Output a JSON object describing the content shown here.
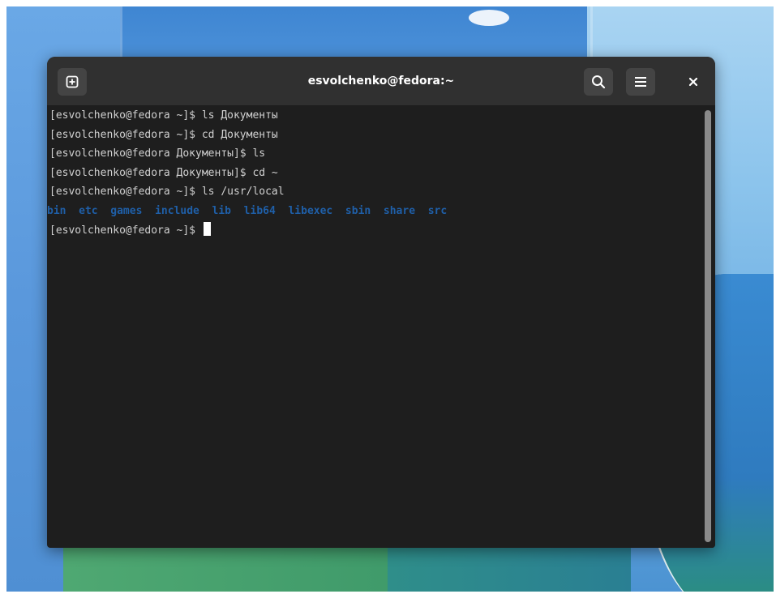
{
  "window": {
    "title": "esvolchenko@fedora:~"
  },
  "icons": {
    "new_tab": "new-tab-icon",
    "search": "search-icon",
    "menu": "hamburger-menu-icon",
    "close": "close-icon"
  },
  "colors": {
    "terminal_bg": "#1e1e1e",
    "titlebar_bg": "#303030",
    "text": "#d0d0d0",
    "directory": "#1f5fa8"
  },
  "terminal": {
    "lines": [
      "[esvolchenko@fedora ~]$ ls Документы",
      "[esvolchenko@fedora ~]$ cd Документы",
      "[esvolchenko@fedora Документы]$ ls",
      "[esvolchenko@fedora Документы]$ cd ~",
      "[esvolchenko@fedora ~]$ ls /usr/local"
    ],
    "ls_output": [
      "bin",
      "etc",
      "games",
      "include",
      "lib",
      "lib64",
      "libexec",
      "sbin",
      "share",
      "src"
    ],
    "prompt": "[esvolchenko@fedora ~]$ "
  }
}
